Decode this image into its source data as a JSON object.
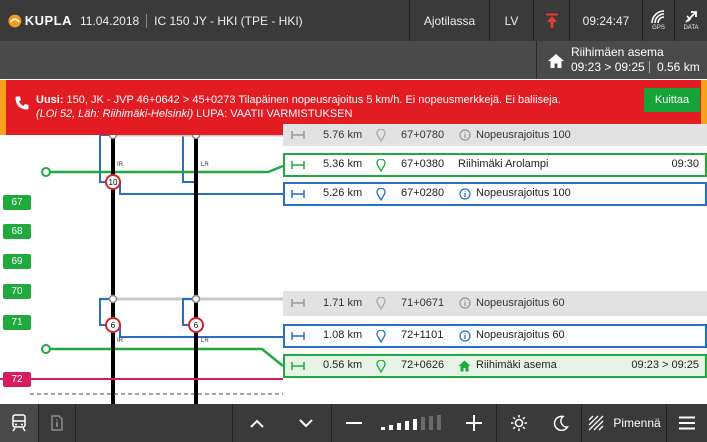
{
  "header": {
    "logo_text": "KUPLA",
    "date": "11.04.2018",
    "train": "IC 150 JY - HKI (TPE - HKI)",
    "mode": "Ajotilassa",
    "lang": "LV",
    "time": "09:24:47",
    "gps_label": "GPS",
    "data_label": "DATA"
  },
  "next_station": {
    "name": "Riihimäen asema",
    "times": "09:23 > 09:25",
    "distance": "0.56 km"
  },
  "alert": {
    "prefix": "Uusi:",
    "text": " 150, JK - JVP 46+0642 > 45+0273 Tilapäinen nopeusrajoitus 5 km/h. Ei nopeusmerkkejä. Ei baliiseja.",
    "detail": "(LOi 52, Läh: Riihimäki-Helsinki)",
    "detail_suffix": " LUPA: VAATII VARMISTUKSEN",
    "ack_label": "Kuittaa"
  },
  "rows": [
    {
      "dist": "5.76 km",
      "pos": "67+0780",
      "label": "Nopeusrajoitus 100",
      "time": ""
    },
    {
      "dist": "5.36 km",
      "pos": "67+0380",
      "label": "Riihimäki Arolampi",
      "time": "09:30"
    },
    {
      "dist": "5.26 km",
      "pos": "67+0280",
      "label": "Nopeusrajoitus 100",
      "time": ""
    },
    {
      "dist": "1.71 km",
      "pos": "71+0671",
      "label": "Nopeusrajoitus 60",
      "time": ""
    },
    {
      "dist": "1.08 km",
      "pos": "72+1101",
      "label": "Nopeusrajoitus 60",
      "time": ""
    },
    {
      "dist": "0.56 km",
      "pos": "72+0626",
      "label": "Riihimäki asema",
      "time": "09:23 > 09:25"
    }
  ],
  "km_markers": [
    "67",
    "68",
    "69",
    "70",
    "71",
    "72"
  ],
  "track_labels": {
    "ir": "IR",
    "lr": "LR"
  },
  "speed_signs": [
    "10",
    "6",
    "6"
  ],
  "footer": {
    "night_label": "Pimennä"
  },
  "colors": {
    "alert_red": "#e31b23",
    "accent_orange": "#f7a21b",
    "green": "#20a93d",
    "blue": "#2a6fc1",
    "magenta": "#d81b60"
  }
}
